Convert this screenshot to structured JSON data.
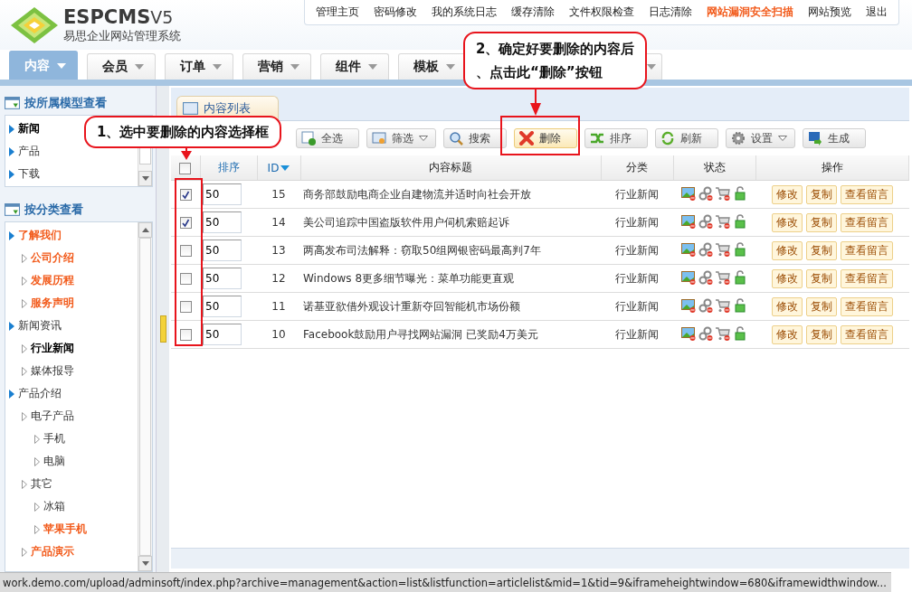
{
  "logo": {
    "name": "ESPCMS",
    "version": "V5",
    "subtitle": "易思企业网站管理系统"
  },
  "top_links": [
    {
      "label": "管理主页",
      "highlighted": false
    },
    {
      "label": "密码修改",
      "highlighted": false
    },
    {
      "label": "我的系统日志",
      "highlighted": false
    },
    {
      "label": "缓存清除",
      "highlighted": false
    },
    {
      "label": "文件权限检查",
      "highlighted": false
    },
    {
      "label": "日志清除",
      "highlighted": false
    },
    {
      "label": "网站漏洞安全扫描",
      "highlighted": true
    },
    {
      "label": "网站预览",
      "highlighted": false
    },
    {
      "label": "退出",
      "highlighted": false
    }
  ],
  "nav_tabs": [
    {
      "label": "内容",
      "selected": true
    },
    {
      "label": "会员",
      "selected": false
    },
    {
      "label": "订单",
      "selected": false
    },
    {
      "label": "营销",
      "selected": false
    },
    {
      "label": "组件",
      "selected": false
    },
    {
      "label": "模板",
      "selected": false
    }
  ],
  "sidebar": {
    "model_title": "按所属模型查看",
    "models": [
      {
        "label": "新闻",
        "selected": true
      },
      {
        "label": "产品",
        "selected": false
      },
      {
        "label": "下载",
        "selected": false
      }
    ],
    "category_title": "按分类查看",
    "categories": [
      {
        "label": "了解我们",
        "highlighted": true,
        "selected": false,
        "children": [
          {
            "label": "公司介绍",
            "highlighted": true,
            "selected": false
          },
          {
            "label": "发展历程",
            "highlighted": true,
            "selected": false
          },
          {
            "label": "服务声明",
            "highlighted": true,
            "selected": false
          }
        ]
      },
      {
        "label": "新闻资讯",
        "highlighted": false,
        "selected": false,
        "children": [
          {
            "label": "行业新闻",
            "highlighted": false,
            "selected": true
          },
          {
            "label": "媒体报导",
            "highlighted": false,
            "selected": false
          }
        ]
      },
      {
        "label": "产品介绍",
        "highlighted": false,
        "selected": false,
        "children": [
          {
            "label": "电子产品",
            "highlighted": false,
            "selected": false,
            "children": [
              {
                "label": "手机",
                "highlighted": false,
                "selected": false
              },
              {
                "label": "电脑",
                "highlighted": false,
                "selected": false
              }
            ]
          },
          {
            "label": "其它",
            "highlighted": false,
            "selected": false,
            "children": [
              {
                "label": "冰箱",
                "highlighted": false,
                "selected": false
              },
              {
                "label": "苹果手机",
                "highlighted": true,
                "selected": false
              }
            ]
          },
          {
            "label": "产品演示",
            "highlighted": true,
            "selected": false
          }
        ]
      }
    ]
  },
  "content_tab": "内容列表",
  "toolbar": [
    {
      "label": "全选",
      "kind": "select",
      "dropdown": false,
      "highlighted": false
    },
    {
      "label": "筛选",
      "kind": "filter",
      "dropdown": true,
      "highlighted": false
    },
    {
      "label": "搜索",
      "kind": "search",
      "dropdown": false,
      "highlighted": false
    },
    {
      "label": "删除",
      "kind": "delete",
      "dropdown": false,
      "highlighted": true
    },
    {
      "label": "排序",
      "kind": "sort",
      "dropdown": false,
      "highlighted": false
    },
    {
      "label": "刷新",
      "kind": "refresh",
      "dropdown": false,
      "highlighted": false
    },
    {
      "label": "设置",
      "kind": "settings",
      "dropdown": true,
      "highlighted": false
    },
    {
      "label": "生成",
      "kind": "generate",
      "dropdown": false,
      "highlighted": false
    }
  ],
  "table": {
    "select_all": {
      "checked": false
    },
    "columns": [
      "排序",
      "ID",
      "内容标题",
      "分类",
      "状态",
      "操作"
    ],
    "rows": [
      {
        "checked": true,
        "sort": "50",
        "id": "15",
        "title": "商务部鼓励电商企业自建物流并适时向社会开放",
        "category": "行业新闻",
        "actions": [
          "修改",
          "复制",
          "查看留言"
        ]
      },
      {
        "checked": true,
        "sort": "50",
        "id": "14",
        "title": "美公司追踪中国盗版软件用户伺机索赔起诉",
        "category": "行业新闻",
        "actions": [
          "修改",
          "复制",
          "查看留言"
        ]
      },
      {
        "checked": false,
        "sort": "50",
        "id": "13",
        "title": "两高发布司法解释：窃取50组网银密码最高判7年",
        "category": "行业新闻",
        "actions": [
          "修改",
          "复制",
          "查看留言"
        ]
      },
      {
        "checked": false,
        "sort": "50",
        "id": "12",
        "title": "Windows 8更多细节曝光：菜单功能更直观",
        "category": "行业新闻",
        "actions": [
          "修改",
          "复制",
          "查看留言"
        ]
      },
      {
        "checked": false,
        "sort": "50",
        "id": "11",
        "title": "诺基亚欲借外观设计重新夺回智能机市场份额",
        "category": "行业新闻",
        "actions": [
          "修改",
          "复制",
          "查看留言"
        ]
      },
      {
        "checked": false,
        "sort": "50",
        "id": "10",
        "title": "Facebook鼓励用户寻找网站漏洞 已奖励4万美元",
        "category": "行业新闻",
        "actions": [
          "修改",
          "复制",
          "查看留言"
        ]
      }
    ]
  },
  "callouts": [
    {
      "lines": [
        "1、选中要删除的内容选择框"
      ]
    },
    {
      "lines": [
        "2、确定好要删除的内容后",
        "、点击此“删除”按钮"
      ]
    }
  ],
  "status_bar": "work.demo.com/upload/adminsoft/index.php?archive=management&action=list&listfunction=articlelist&mid=1&tid=9&iframeheightwindow=680&iframewidthwindow..."
}
